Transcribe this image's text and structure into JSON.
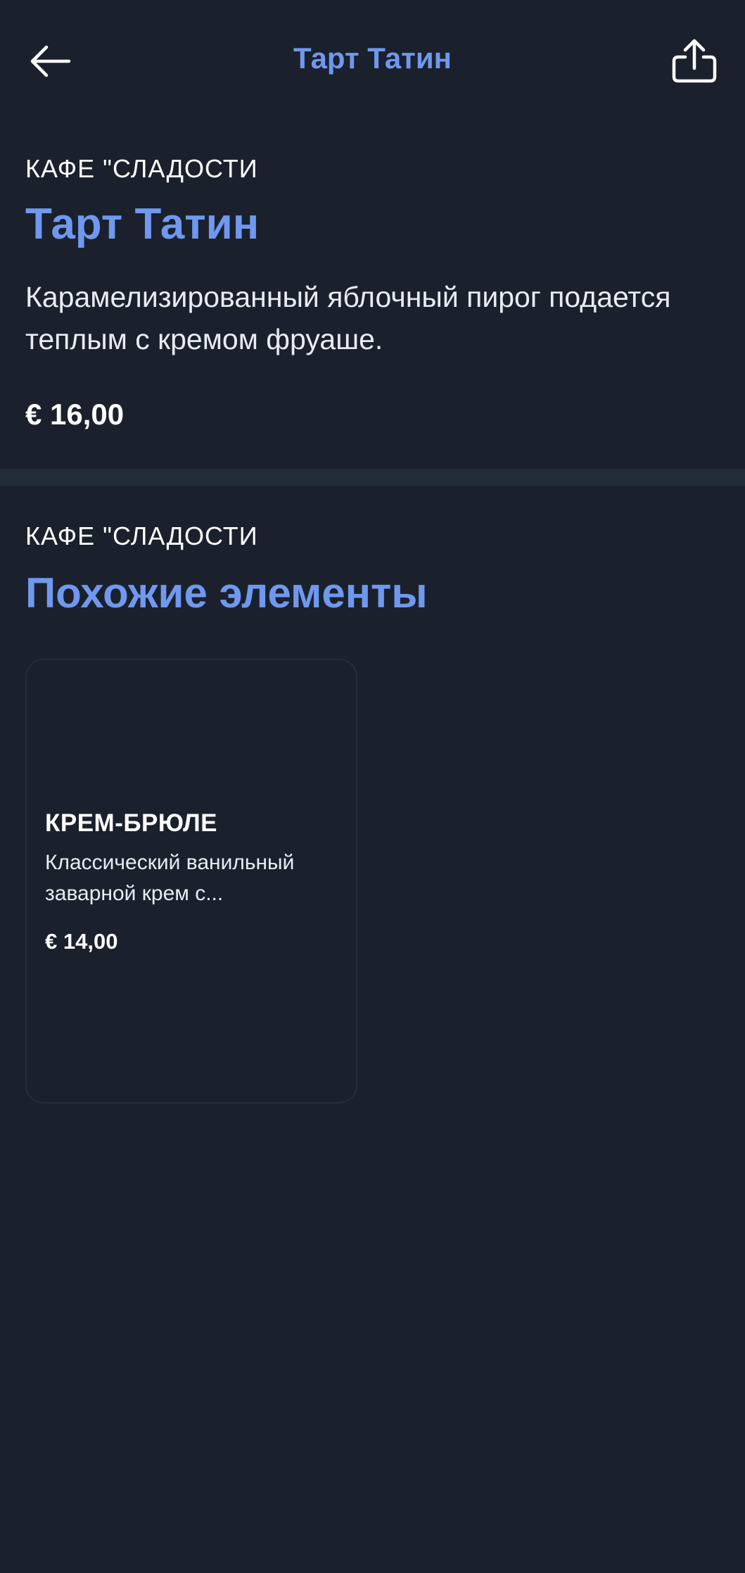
{
  "header": {
    "title": "Тарт Татин",
    "back_icon": "arrow-left-icon",
    "share_icon": "share-icon"
  },
  "item": {
    "restaurant": "КАФЕ \"СЛАДОСТИ",
    "name": "Тарт Татин",
    "description": "Карамелизированный яблочный пирог подается теплым с кремом фруаше.",
    "price": "€ 16,00"
  },
  "similar": {
    "restaurant": "КАФЕ \"СЛАДОСТИ",
    "heading": "Похожие элементы",
    "items": [
      {
        "name": "КРЕМ-БРЮЛЕ",
        "description": "Классический ванильный заварной крем с...",
        "price": "€ 14,00"
      }
    ]
  },
  "colors": {
    "background": "#1b212c",
    "accent": "#6f98ee",
    "divider": "#222b38",
    "text": "#ffffff"
  }
}
